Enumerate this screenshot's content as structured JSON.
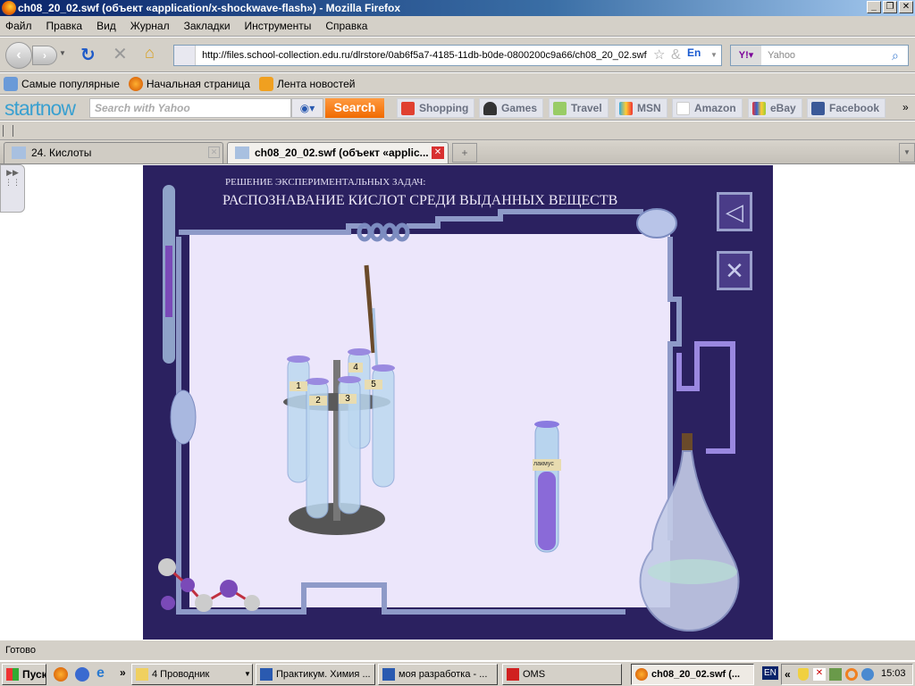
{
  "window": {
    "title": "ch08_20_02.swf (объект «application/x-shockwave-flash») - Mozilla Firefox"
  },
  "menu": [
    "Файл",
    "Правка",
    "Вид",
    "Журнал",
    "Закладки",
    "Инструменты",
    "Справка"
  ],
  "nav": {
    "url": "http://files.school-collection.edu.ru/dlrstore/0ab6f5a7-4185-11db-b0de-0800200c9a66/ch08_20_02.swf",
    "search_placeholder": "Yahoo",
    "lang_badge": "En"
  },
  "bookmarks": [
    "Самые популярные",
    "Начальная страница",
    "Лента новостей"
  ],
  "startnow": {
    "logo": "startnow",
    "search_placeholder": "Search with Yahoo",
    "search_button": "Search",
    "links": [
      "Shopping",
      "Games",
      "Travel",
      "MSN",
      "Amazon",
      "eBay",
      "Facebook"
    ],
    "more": "»"
  },
  "tabs": [
    {
      "label": "24. Кислоты",
      "active": false
    },
    {
      "label": "ch08_20_02.swf (объект «applic...",
      "active": true
    }
  ],
  "flash": {
    "subtitle": "РЕШЕНИЕ ЭКСПЕРИМЕНТАЛЬНЫХ ЗАДАЧ:",
    "title": "РАСПОЗНАВАНИЕ КИСЛОТ СРЕДИ ВЫДАННЫХ ВЕЩЕСТВ",
    "tube_labels": [
      "1",
      "2",
      "3",
      "4",
      "5"
    ],
    "indicator_label": "лакмус",
    "colors": {
      "background": "#2b2160",
      "panel": "#ece6fb",
      "indicator": "#8a6ad8"
    }
  },
  "status": {
    "text": "Готово"
  },
  "taskbar": {
    "start": "Пуск",
    "items": [
      "4 Проводник",
      "Практикум. Химия ...",
      "моя разработка - ...",
      "OMS",
      "ch08_20_02.swf (..."
    ],
    "lang": "EN",
    "clock": "15:03"
  }
}
